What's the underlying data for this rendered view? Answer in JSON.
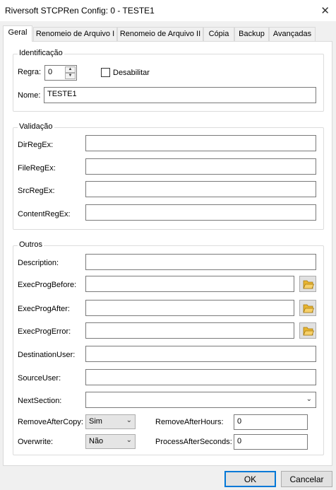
{
  "window": {
    "title": "Riversoft STCPRen Config: 0 - TESTE1",
    "close_glyph": "✕"
  },
  "tabs": [
    {
      "label": "Geral"
    },
    {
      "label": "Renomeio de Arquivo I"
    },
    {
      "label": "Renomeio de Arquivo II"
    },
    {
      "label": "Cópia"
    },
    {
      "label": "Backup"
    },
    {
      "label": "Avançadas"
    }
  ],
  "identificacao": {
    "legend": "Identificação",
    "regra_label": "Regra:",
    "regra_value": "0",
    "desabilitar_label": "Desabilitar",
    "nome_label": "Nome:",
    "nome_value": "TESTE1"
  },
  "validacao": {
    "legend": "Validação",
    "dirregex_label": "DirRegEx:",
    "fileregex_label": "FileRegEx:",
    "srcregex_label": "SrcRegEx:",
    "contentregex_label": "ContentRegEx:"
  },
  "outros": {
    "legend": "Outros",
    "description_label": "Description:",
    "execprogbefore_label": "ExecProgBefore:",
    "execprogafter_label": "ExecProgAfter:",
    "execprogerror_label": "ExecProgError:",
    "destinationuser_label": "DestinationUser:",
    "sourceuser_label": "SourceUser:",
    "nextsection_label": "NextSection:",
    "removeaftercopy_label": "RemoveAfterCopy:",
    "removeaftercopy_value": "Sim",
    "overwrite_label": "Overwrite:",
    "overwrite_value": "Não",
    "removeafterhours_label": "RemoveAfterHours:",
    "removeafterhours_value": "0",
    "processafterseconds_label": "ProcessAfterSeconds:",
    "processafterseconds_value": "0"
  },
  "footer": {
    "ok_label": "OK",
    "cancel_label": "Cancelar"
  },
  "icons": {
    "folder": "folder-open-icon",
    "chevron": "chevron-down-icon"
  },
  "colors": {
    "default_button_border": "#0078d7",
    "folder_icon": "#e8b530"
  }
}
